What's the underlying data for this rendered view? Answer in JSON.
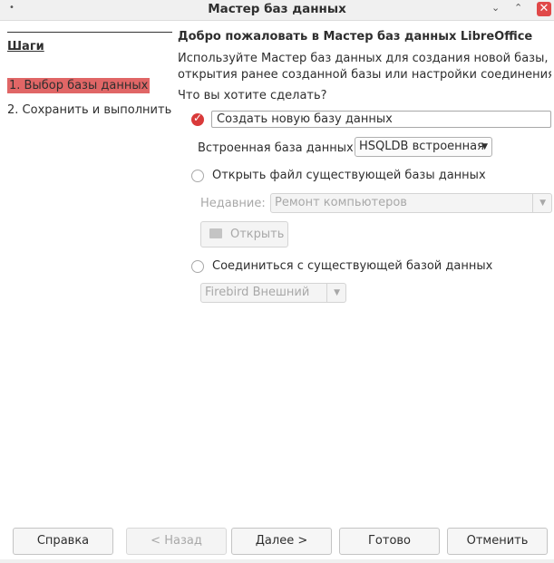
{
  "window": {
    "title": "Мастер баз данных"
  },
  "steps": {
    "title": "Шаги",
    "items": [
      "1. Выбор базы данных",
      "2. Сохранить и выполнить"
    ]
  },
  "main": {
    "heading": "Добро пожаловать в Мастер баз данных LibreOffice",
    "description_line1": "Используйте Мастер баз данных для создания новой базы,",
    "description_line2": "открытия ранее созданной базы или настройки соединения к се...",
    "question": "Что вы хотите сделать?",
    "option_create": "Создать новую базу данных",
    "embedded_label": "Встроенная база данных:",
    "embedded_value": "HSQLDB встроенная",
    "option_open": "Открыть файл существующей базы данных",
    "recent_label": "Недавние:",
    "recent_value": "Ремонт компьютеров",
    "open_button": "Открыть",
    "option_connect": "Соединиться с существующей базой данных",
    "connect_value": "Firebird Внешний"
  },
  "footer": {
    "help": "Справка",
    "back": "< Назад",
    "next": "Далее >",
    "finish": "Готово",
    "cancel": "Отменить"
  },
  "colors": {
    "accent": "#d93a3a",
    "selected_step": "#e06666",
    "close": "#e04848"
  }
}
